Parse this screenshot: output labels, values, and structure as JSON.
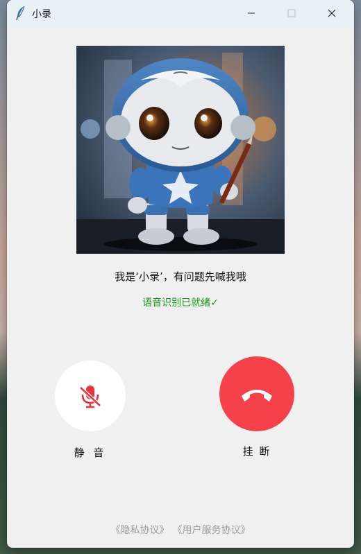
{
  "window": {
    "title": "小录",
    "controls": [
      "minimize-icon",
      "maximize-icon",
      "close-icon"
    ]
  },
  "hero": {
    "icon": "robot-avatar"
  },
  "greeting": "我是‘小录’，有问题先喊我哦",
  "status": "语音识别已就绪✓",
  "controls": {
    "mute_label": "静 音",
    "mute_icon": "mic-off-icon",
    "hangup_label": "挂 断",
    "hangup_icon": "phone-hangup-icon"
  },
  "footer": {
    "privacy": "《隐私协议》",
    "service": "《用户服务协议》"
  },
  "colors": {
    "titlebar": "#e8f1f6",
    "window_bg": "#f0f0f0",
    "status_green": "#1a9a1a",
    "hangup_red": "#f4414a",
    "mute_icon_red": "#e8343e",
    "footer_gray": "#9a9a9a"
  }
}
